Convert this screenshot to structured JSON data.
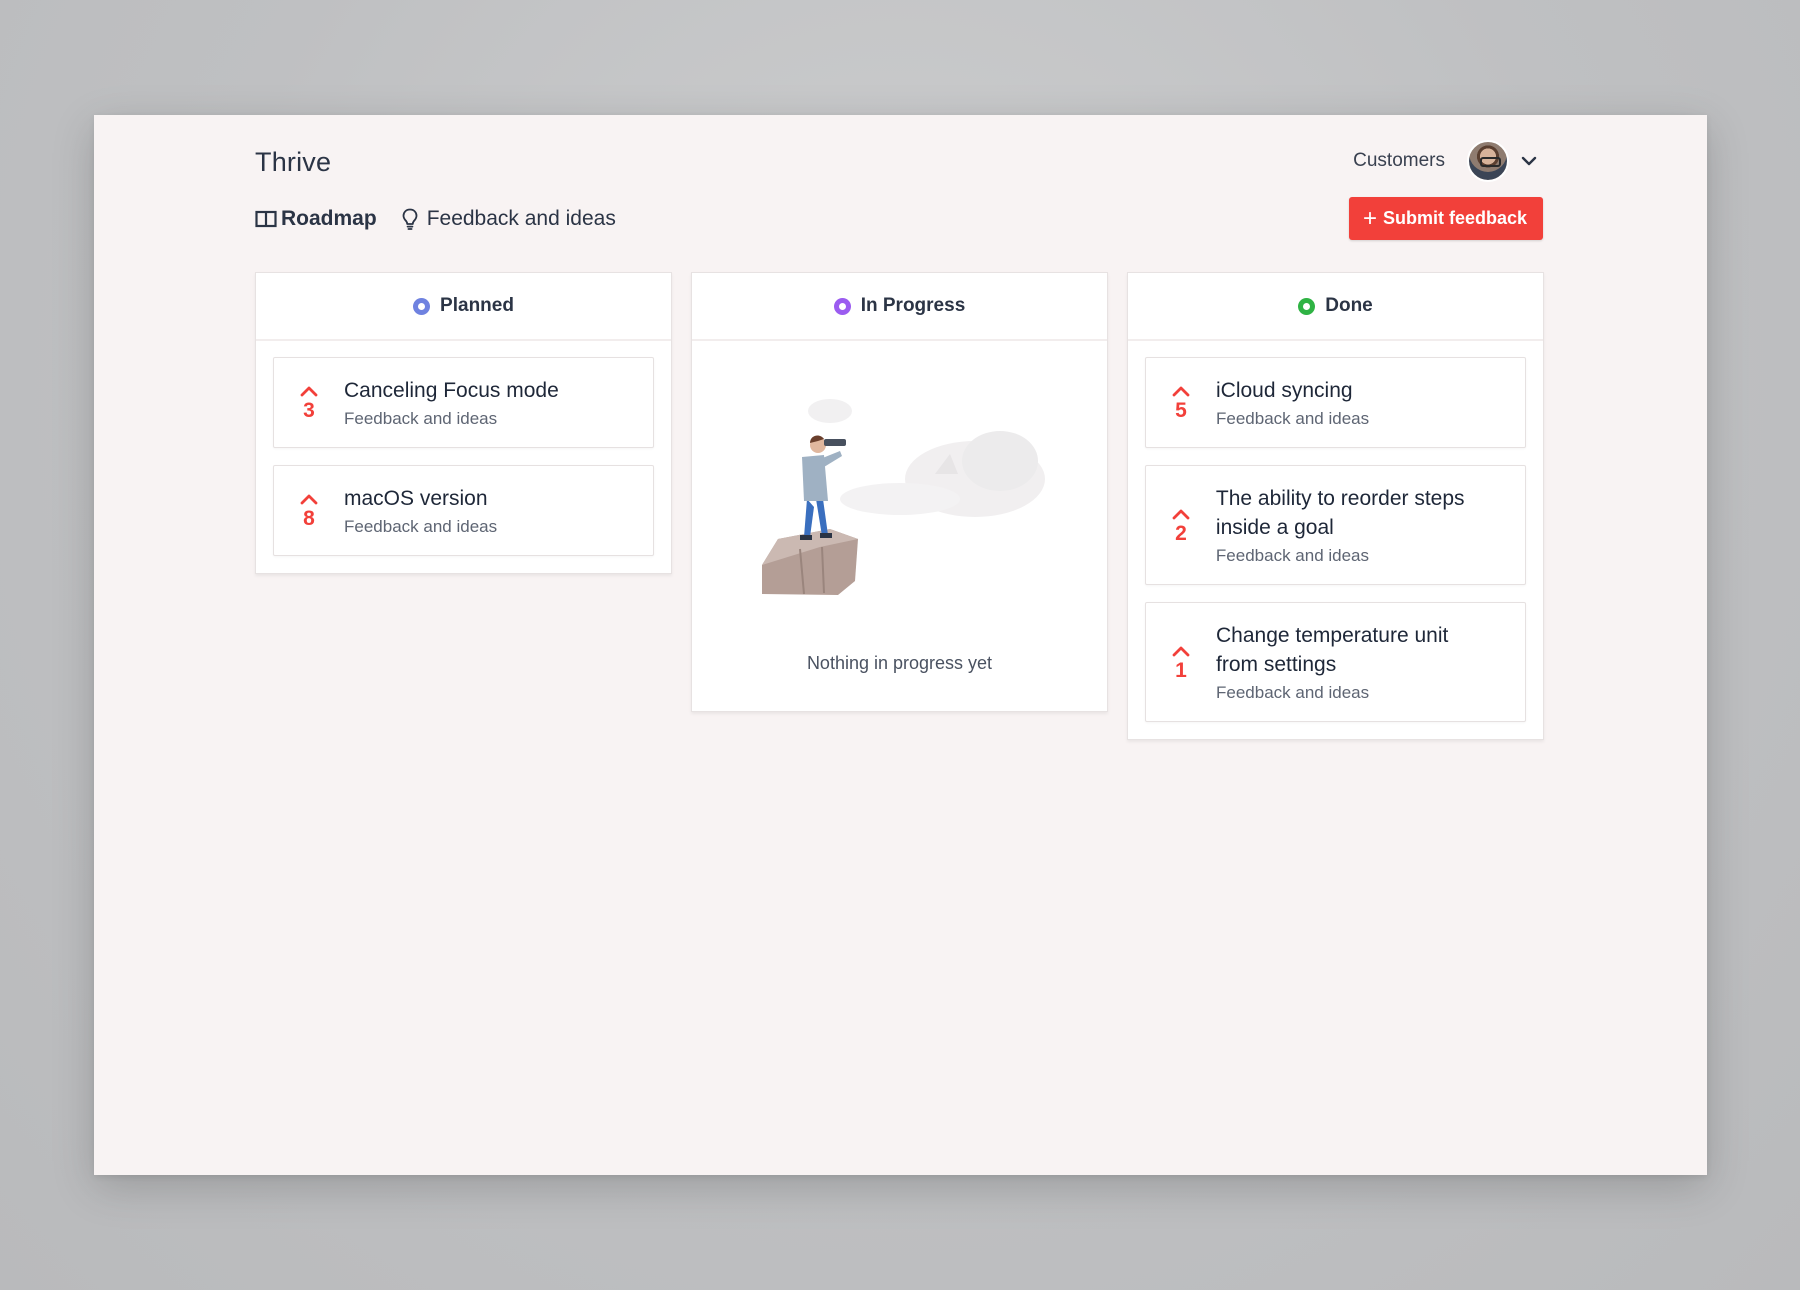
{
  "app": {
    "title": "Thrive"
  },
  "header": {
    "customers_label": "Customers",
    "avatar_icon": "user-avatar",
    "menu_icon": "chevron-down-icon"
  },
  "nav": {
    "roadmap_label": "Roadmap",
    "roadmap_icon": "board-icon",
    "feedback_label": "Feedback and ideas",
    "feedback_icon": "lightbulb-icon",
    "active": "Roadmap"
  },
  "actions": {
    "submit_label": "Submit feedback",
    "submit_icon": "plus-icon"
  },
  "colors": {
    "accent": "#f2403a",
    "planned": "#6f82e0",
    "in_progress": "#9b5cf0",
    "done": "#2fb344",
    "background": "#f8f3f3"
  },
  "columns": {
    "planned": {
      "title": "Planned",
      "items": [
        {
          "title": "Canceling Focus mode",
          "category": "Feedback and ideas",
          "votes": "3"
        },
        {
          "title": "macOS version",
          "category": "Feedback and ideas",
          "votes": "8"
        }
      ]
    },
    "in_progress": {
      "title": "In Progress",
      "empty_text": "Nothing in progress yet",
      "items": []
    },
    "done": {
      "title": "Done",
      "items": [
        {
          "title": "iCloud syncing",
          "category": "Feedback and ideas",
          "votes": "5"
        },
        {
          "title": "The ability to reorder steps inside a goal",
          "category": "Feedback and ideas",
          "votes": "2"
        },
        {
          "title": "Change temperature unit from settings",
          "category": "Feedback and ideas",
          "votes": "1"
        }
      ]
    }
  }
}
